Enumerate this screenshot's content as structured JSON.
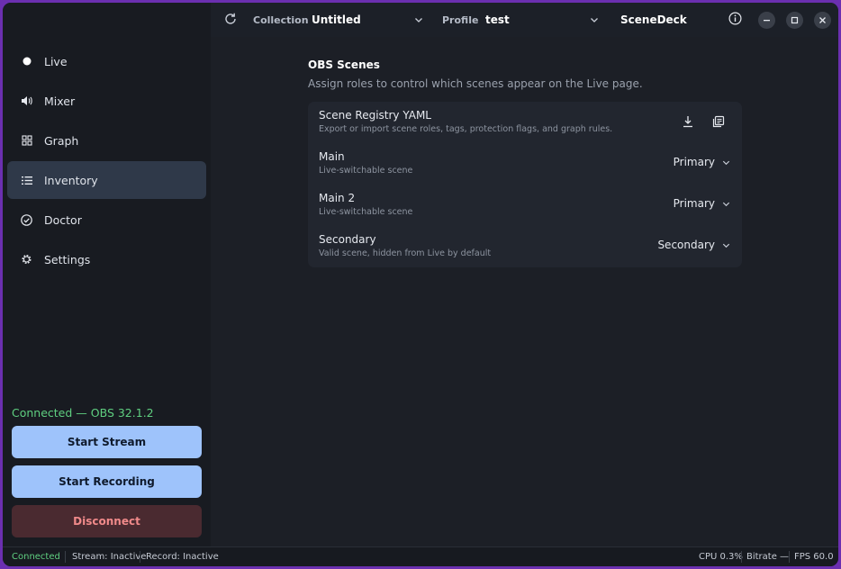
{
  "nav": {
    "items": [
      {
        "label": "Live",
        "icon": "dot-icon"
      },
      {
        "label": "Mixer",
        "icon": "speaker-icon"
      },
      {
        "label": "Graph",
        "icon": "grid-icon"
      },
      {
        "label": "Inventory",
        "icon": "list-icon",
        "active": true
      },
      {
        "label": "Doctor",
        "icon": "check-circle-icon"
      },
      {
        "label": "Settings",
        "icon": "gear-icon"
      }
    ]
  },
  "sidebar": {
    "connection_status": "Connected — OBS 32.1.2",
    "start_stream": "Start Stream",
    "start_recording": "Start Recording",
    "disconnect": "Disconnect"
  },
  "topbar": {
    "collection_label": "Collection",
    "collection_value": "Untitled",
    "profile_label": "Profile",
    "profile_value": "test",
    "app_name": "SceneDeck"
  },
  "main": {
    "title": "OBS Scenes",
    "subtitle": "Assign roles to control which scenes appear on the Live page.",
    "registry": {
      "title": "Scene Registry YAML",
      "description": "Export or import scene roles, tags, protection flags, and graph rules."
    },
    "scenes": [
      {
        "name": "Main",
        "description": "Live-switchable scene",
        "role": "Primary"
      },
      {
        "name": "Main 2",
        "description": "Live-switchable scene",
        "role": "Primary"
      },
      {
        "name": "Secondary",
        "description": "Valid scene, hidden from Live by default",
        "role": "Secondary"
      }
    ]
  },
  "statusbar": {
    "connected": "Connected",
    "stream": "Stream: Inactive",
    "record": "Record: Inactive",
    "cpu": "CPU 0.3%",
    "bitrate": "Bitrate —",
    "fps": "FPS 60.0"
  },
  "colors": {
    "accent": "#9ec3fb",
    "success": "#5fcf80",
    "danger": "#f08a8a",
    "frame": "#6b2fb0"
  }
}
